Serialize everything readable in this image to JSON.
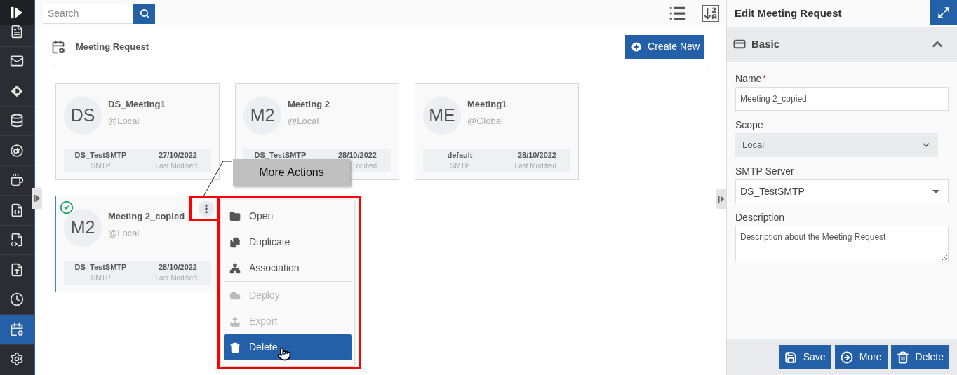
{
  "nav": [
    {
      "kind": "document",
      "selected": false
    },
    {
      "kind": "mail",
      "selected": false
    },
    {
      "kind": "diamond",
      "selected": false
    },
    {
      "kind": "database",
      "selected": false
    },
    {
      "kind": "circle",
      "selected": false
    },
    {
      "kind": "java",
      "selected": false
    },
    {
      "kind": "tsfile",
      "selected": false
    },
    {
      "kind": "cssfile",
      "selected": false
    },
    {
      "kind": "textfile",
      "selected": false
    },
    {
      "kind": "clock",
      "selected": false
    },
    {
      "kind": "calendar",
      "selected": true
    },
    {
      "kind": "gear",
      "selected": false
    }
  ],
  "search": {
    "placeholder": "Search"
  },
  "page": {
    "title": "Meeting Request",
    "create_button": "Create New"
  },
  "cards": [
    {
      "initials": "DS",
      "title": "DS_Meeting1",
      "scope": "@Local",
      "server": "DS_TestSMTP",
      "server_label": "SMTP",
      "date": "27/10/2022",
      "date_label": "Last Modified",
      "selected": false
    },
    {
      "initials": "M2",
      "title": "Meeting 2",
      "scope": "@Local",
      "server": "DS_TestSMTP",
      "date": "28/10/2022",
      "date_label": "odified",
      "selected": false
    },
    {
      "initials": "ME",
      "title": "Meeting1",
      "scope": "@Global",
      "server": "default",
      "server_label": "SMTP",
      "date": "28/10/2022",
      "date_label": "Last Modified",
      "selected": false
    },
    {
      "initials": "M2",
      "title": "Meeting 2_copied",
      "scope": "@Local",
      "server": "DS_TestSMTP",
      "server_label": "SMTP",
      "date": "28/10/2022",
      "date_label": "Last Modified",
      "selected": true
    }
  ],
  "callout": {
    "text": "More Actions"
  },
  "context_menu": {
    "items": [
      {
        "label": "Open",
        "disabled": false,
        "selected": false,
        "divider_after": false
      },
      {
        "label": "Duplicate",
        "disabled": false,
        "selected": false,
        "divider_after": false
      },
      {
        "label": "Association",
        "disabled": false,
        "selected": false,
        "divider_after": true
      },
      {
        "label": "Deploy",
        "disabled": true,
        "selected": false,
        "divider_after": false
      },
      {
        "label": "Export",
        "disabled": true,
        "selected": false,
        "divider_after": false
      },
      {
        "label": "Delete",
        "disabled": false,
        "selected": true,
        "divider_after": false
      }
    ]
  },
  "panel": {
    "title": "Edit Meeting Request",
    "section": {
      "title": "Basic",
      "expanded": true
    },
    "fields": [
      {
        "kind": "text",
        "label": "Name",
        "required_mark": "*",
        "disabled": false,
        "value": "Meeting 2_copied"
      },
      {
        "kind": "select",
        "label": "Scope",
        "disabled": true,
        "value": "Local"
      },
      {
        "kind": "dropdown",
        "label": "SMTP Server",
        "disabled": false,
        "value": "DS_TestSMTP"
      },
      {
        "kind": "textarea",
        "label": "Description",
        "disabled": false,
        "value": "Description about the Meeting Request"
      }
    ],
    "buttons": [
      "Save",
      "More",
      "Delete"
    ]
  }
}
